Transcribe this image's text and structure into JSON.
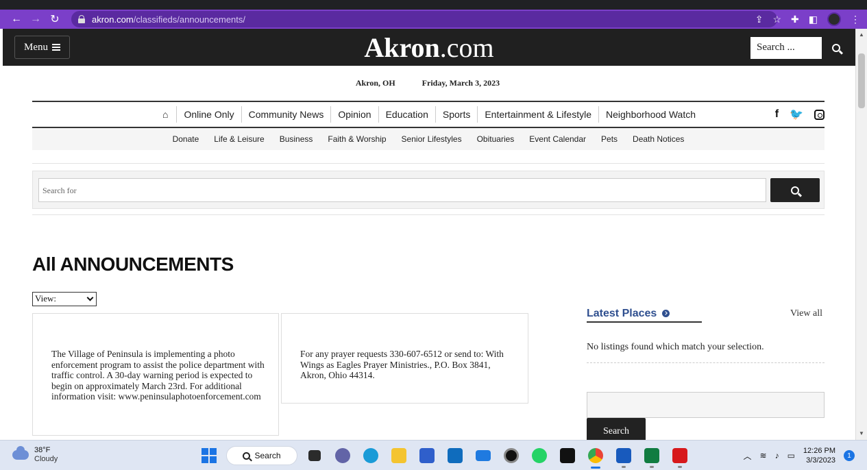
{
  "browser": {
    "url_host": "akron.com",
    "url_path": "/classifieds/announcements/"
  },
  "header": {
    "menu_label": "Menu",
    "logo_main": "Akron",
    "logo_suffix": ".com",
    "search_placeholder": "Search ..."
  },
  "dateline": {
    "location": "Akron, OH",
    "date": "Friday, March 3, 2023"
  },
  "main_nav": [
    "Online Only",
    "Community News",
    "Opinion",
    "Education",
    "Sports",
    "Entertainment & Lifestyle",
    "Neighborhood Watch"
  ],
  "sub_nav": [
    "Donate",
    "Life & Leisure",
    "Business",
    "Faith & Worship",
    "Senior Lifestyles",
    "Obituaries",
    "Event Calendar",
    "Pets",
    "Death Notices"
  ],
  "search": {
    "placeholder": "Search for"
  },
  "page": {
    "title": "All ANNOUNCEMENTS",
    "view_select": "View:"
  },
  "announcements": [
    {
      "text": "The Village of Peninsula is implementing a photo enforcement program to assist the police department with traffic control. A 30-day warning period is expected to begin on approximately March 23rd. For additional information visit: www.peninsulaphotoenforcement.com"
    },
    {
      "text": "For any prayer requests 330-607-6512 or send to: With Wings as Eagles Prayer Ministries., P.O. Box 3841, Akron, Ohio 44314."
    }
  ],
  "sidebar": {
    "heading": "Latest Places",
    "view_all": "View all",
    "empty_message": "No listings found which match your selection.",
    "search_button": "Search"
  },
  "taskbar": {
    "weather_temp": "38°F",
    "weather_desc": "Cloudy",
    "search_label": "Search",
    "time": "12:26 PM",
    "date": "3/3/2023",
    "notifications": "1"
  }
}
